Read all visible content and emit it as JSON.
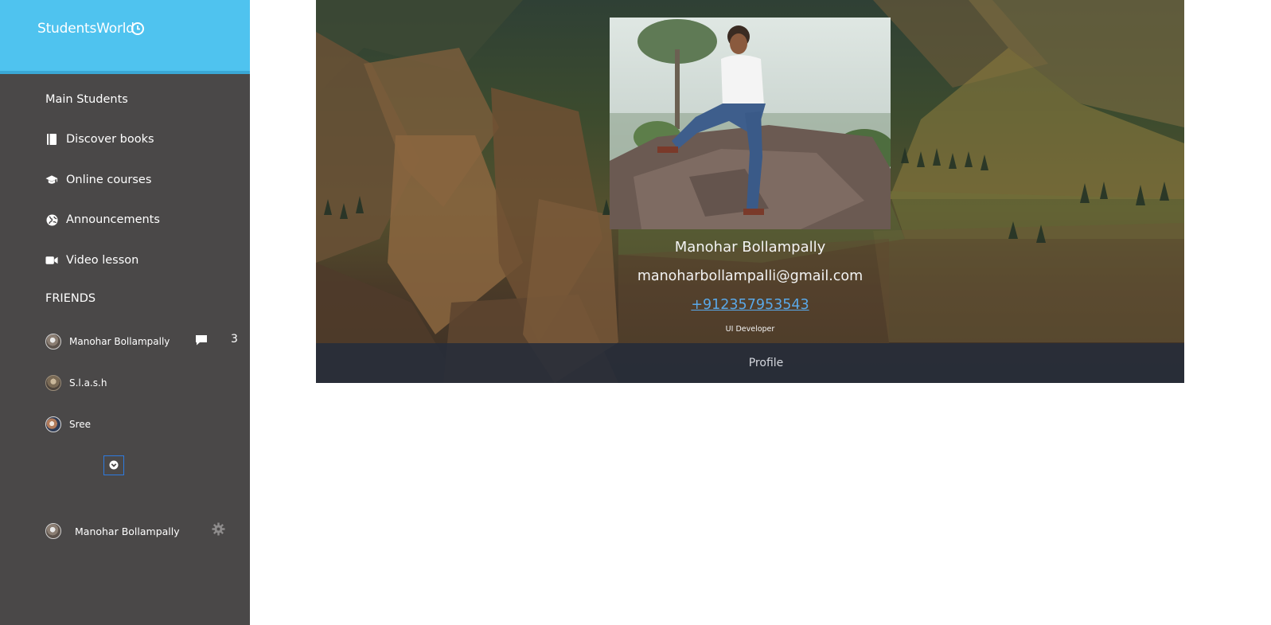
{
  "brand": {
    "title": "StudentsWorld",
    "icon": "clock-icon"
  },
  "nav": {
    "items": [
      {
        "label": "Main Students",
        "icon": ""
      },
      {
        "label": "Discover books",
        "icon": "book-icon"
      },
      {
        "label": "Online courses",
        "icon": "graduation-cap-icon"
      },
      {
        "label": "Announcements",
        "icon": "globe-icon"
      },
      {
        "label": "Video lesson",
        "icon": "video-camera-icon"
      }
    ]
  },
  "friends": {
    "heading": "FRIENDS",
    "list": [
      {
        "name": "Manohar Bollampally",
        "message_count": "3",
        "icon": "chat-icon"
      },
      {
        "name": "S.l.a.s.h"
      },
      {
        "name": "Sree"
      }
    ],
    "expand_icon": "chevron-down-circle-icon"
  },
  "current_user": {
    "name": "Manohar Bollampally",
    "settings_icon": "gear-icon"
  },
  "profile": {
    "name": "Manohar Bollampally",
    "email": "manoharbollampalli@gmail.com",
    "phone": "+912357953543",
    "role": "UI Developer",
    "footer_label": "Profile"
  },
  "colors": {
    "brand_bg": "#4fc3ef",
    "sidebar_bg": "#4a4848",
    "link": "#5aa8e8",
    "card_footer": "#262c3a"
  }
}
